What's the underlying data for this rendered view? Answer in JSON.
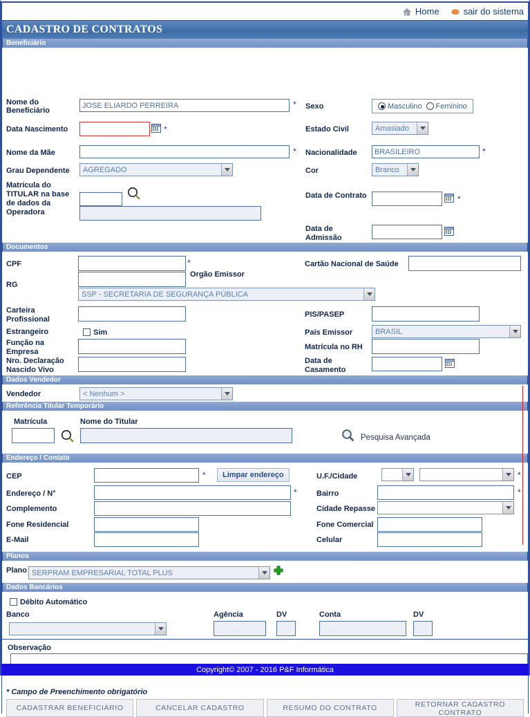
{
  "topbar": {
    "home": "Home",
    "logout": "sair do sistema"
  },
  "title": "CADASTRO DE CONTRATOS",
  "sections": {
    "beneficiario": "Beneficiário",
    "documentos": "Documentos",
    "dados_vendedor": "Dados Vendedor",
    "referencia_titular": "Referência Titular Temporário",
    "endereco_contato": "Endereço / Contato",
    "planos": "Planos",
    "dados_bancarios": "Dados Bancários"
  },
  "beneficiario": {
    "nome_label": "Nome do Beneficiário",
    "nome_value": "JOSE ELIARDO PERREIRA",
    "sexo_label": "Sexo",
    "sexo_masculino": "Masculino",
    "sexo_feminino": "Feminino",
    "sexo_selected": "Masculino",
    "data_nascimento_label": "Data Nascimento",
    "data_nascimento_value": "",
    "estado_civil_label": "Estado Civil",
    "estado_civil_value": "Amasiado",
    "nome_mae_label": "Nome da Mãe",
    "nome_mae_value": "",
    "nacionalidade_label": "Nacionalidade",
    "nacionalidade_value": "BRASILEIRO",
    "grau_dependente_label": "Grau Dependente",
    "grau_dependente_value": "AGREGADO",
    "cor_label": "Cor",
    "cor_value": "Branco",
    "matricula_titular_label": "Matrícula do TITULAR na base de dados da Operadora",
    "matricula_titular_value": "",
    "matricula_titular_nome": "",
    "data_contrato_label": "Data de Contrato",
    "data_contrato_value": "",
    "data_admissao_label": "Data de Admissão",
    "data_admissao_value": ""
  },
  "documentos": {
    "cpf_label": "CPF",
    "cpf_value": "",
    "cartao_saude_label": "Cartão Nacional de Saúde",
    "cartao_saude_value": "",
    "rg_label": "RG",
    "rg_value": "",
    "orgao_emissor_label": "Orgão Emissor",
    "orgao_emissor_value": "SSP - SECRETARIA DE SEGURANÇA PÚBLICA",
    "carteira_profissional_label": "Carteira Profissional",
    "carteira_profissional_value": "",
    "pis_pasep_label": "PIS/PASEP",
    "pis_pasep_value": "",
    "estrangeiro_label": "Estrangeiro",
    "estrangeiro_sim": "Sim",
    "pais_emissor_label": "Pais Emissor",
    "pais_emissor_value": "BRASIL",
    "funcao_empresa_label": "Função na Empresa",
    "funcao_empresa_value": "",
    "matricula_rh_label": "Matrícula no RH",
    "matricula_rh_value": "",
    "nro_declaracao_label": "Nro. Declaração Nascido Vivo",
    "nro_declaracao_value": "",
    "data_casamento_label": "Data de Casamento",
    "data_casamento_value": ""
  },
  "vendedor": {
    "label": "Vendedor",
    "value": "< Nenhum >"
  },
  "referencia": {
    "matricula_label": "Matrícula",
    "matricula_value": "",
    "nome_titular_label": "Nome do Titular",
    "nome_titular_value": "",
    "pesquisa_avancada": "Pesquisa Avançada"
  },
  "endereco": {
    "cep_label": "CEP",
    "cep_value": "",
    "limpar_endereco": "Limpar endereço",
    "uf_cidade_label": "U.F./Cidade",
    "uf_value": "",
    "cidade_value": "",
    "endereco_label": "Endereço / N°",
    "endereco_value": "",
    "bairro_label": "Bairro",
    "bairro_value": "",
    "complemento_label": "Complemento",
    "complemento_value": "",
    "cidade_repasse_label": "Cidade Repasse",
    "cidade_repasse_value": "",
    "fone_residencial_label": "Fone Residencial",
    "fone_residencial_value": "",
    "fone_comercial_label": "Fone Comercial",
    "fone_comercial_value": "",
    "email_label": "E-Mail",
    "email_value": "",
    "celular_label": "Celular",
    "celular_value": ""
  },
  "planos": {
    "plano_label": "Plano",
    "plano_value": "SERPRAM EMPRESARIAL TOTAL PLUS"
  },
  "bancarios": {
    "debito_automatico_label": "Débito Automático",
    "banco_label": "Banco",
    "banco_value": "",
    "agencia_label": "Agência",
    "agencia_value": "",
    "dv1_label": "DV",
    "dv1_value": "",
    "conta_label": "Conta",
    "conta_value": "",
    "dv2_label": "DV",
    "dv2_value": ""
  },
  "observacao": {
    "label": "Observação",
    "value": ""
  },
  "footer_note": "* Campo de Preenchimento obrigatório",
  "buttons": {
    "cadastrar": "CADASTRAR BENEFICIÁRIO",
    "cancelar": "CANCELAR CADASTRO",
    "resumo": "RESUMO DO CONTRATO",
    "retornar": "RETORNAR CADASTRO CONTRATO"
  },
  "copyright": "Copyright© 2007 - 2016 P&F Informática",
  "colors": {
    "title_blue": "#4573ad",
    "section_blue": "#7e9bcd",
    "footer_blue": "#1b0fe0",
    "required_red": "#e02020",
    "link_blue": "#163a78"
  }
}
